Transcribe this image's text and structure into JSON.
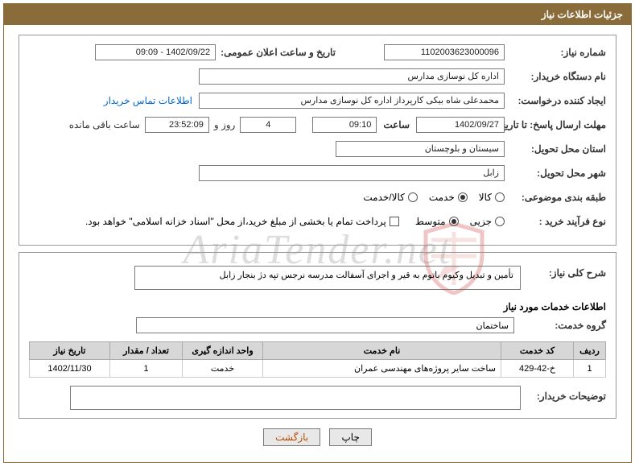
{
  "header": {
    "title": "جزئیات اطلاعات نیاز"
  },
  "fields": {
    "need_number_label": "شماره نیاز:",
    "need_number": "1102003623000096",
    "announce_label": "تاریخ و ساعت اعلان عمومی:",
    "announce_value": "1402/09/22 - 09:09",
    "buyer_org_label": "نام دستگاه خریدار:",
    "buyer_org": "اداره کل نوسازی مدارس",
    "requester_label": "ایجاد کننده درخواست:",
    "requester": "محمدعلی شاه بیکی کارپرداز اداره کل نوسازی مدارس",
    "contact_link": "اطلاعات تماس خریدار",
    "deadline_label": "مهلت ارسال پاسخ:",
    "until_label": "تا تاریخ:",
    "deadline_date": "1402/09/27",
    "time_label": "ساعت",
    "deadline_time": "09:10",
    "days_value": "4",
    "days_word": "روز و",
    "hms_value": "23:52:09",
    "remaining_label": "ساعت باقی مانده",
    "province_label": "استان محل تحویل:",
    "province": "سیستان و بلوچستان",
    "city_label": "شهر محل تحویل:",
    "city": "زابل",
    "subject_class_label": "طبقه بندی موضوعی:",
    "radio_goods": "کالا",
    "radio_service": "خدمت",
    "radio_both": "کالا/خدمت",
    "process_label": "نوع فرآیند خرید :",
    "radio_partial": "جزیی",
    "radio_medium": "متوسط",
    "payment_note": "پرداخت تمام یا بخشی از مبلغ خرید،از محل \"اسناد خزانه اسلامی\" خواهد بود.",
    "general_desc_label": "شرح کلی نیاز:",
    "general_desc": "تأمین و تبدیل وکیوم باتوم به قیر و اجرای آسفالت مدرسه نرجس تپه دژ بنجار زابل",
    "service_info_title": "اطلاعات خدمات مورد نیاز",
    "service_group_label": "گروه خدمت:",
    "service_group": "ساختمان",
    "buyer_comment_label": "توضیحات خریدار:"
  },
  "table": {
    "headers": {
      "row": "ردیف",
      "service_code": "کد خدمت",
      "service_name": "نام خدمت",
      "unit": "واحد اندازه گیری",
      "qty": "تعداد / مقدار",
      "need_date": "تاریخ نیاز"
    },
    "rows": [
      {
        "row": "1",
        "service_code": "خ-42-429",
        "service_name": "ساخت سایر پروژه‌های مهندسی عمران",
        "unit": "خدمت",
        "qty": "1",
        "need_date": "1402/11/30"
      }
    ]
  },
  "buttons": {
    "print": "چاپ",
    "back": "بازگشت"
  },
  "watermark": "AriaTender.net"
}
